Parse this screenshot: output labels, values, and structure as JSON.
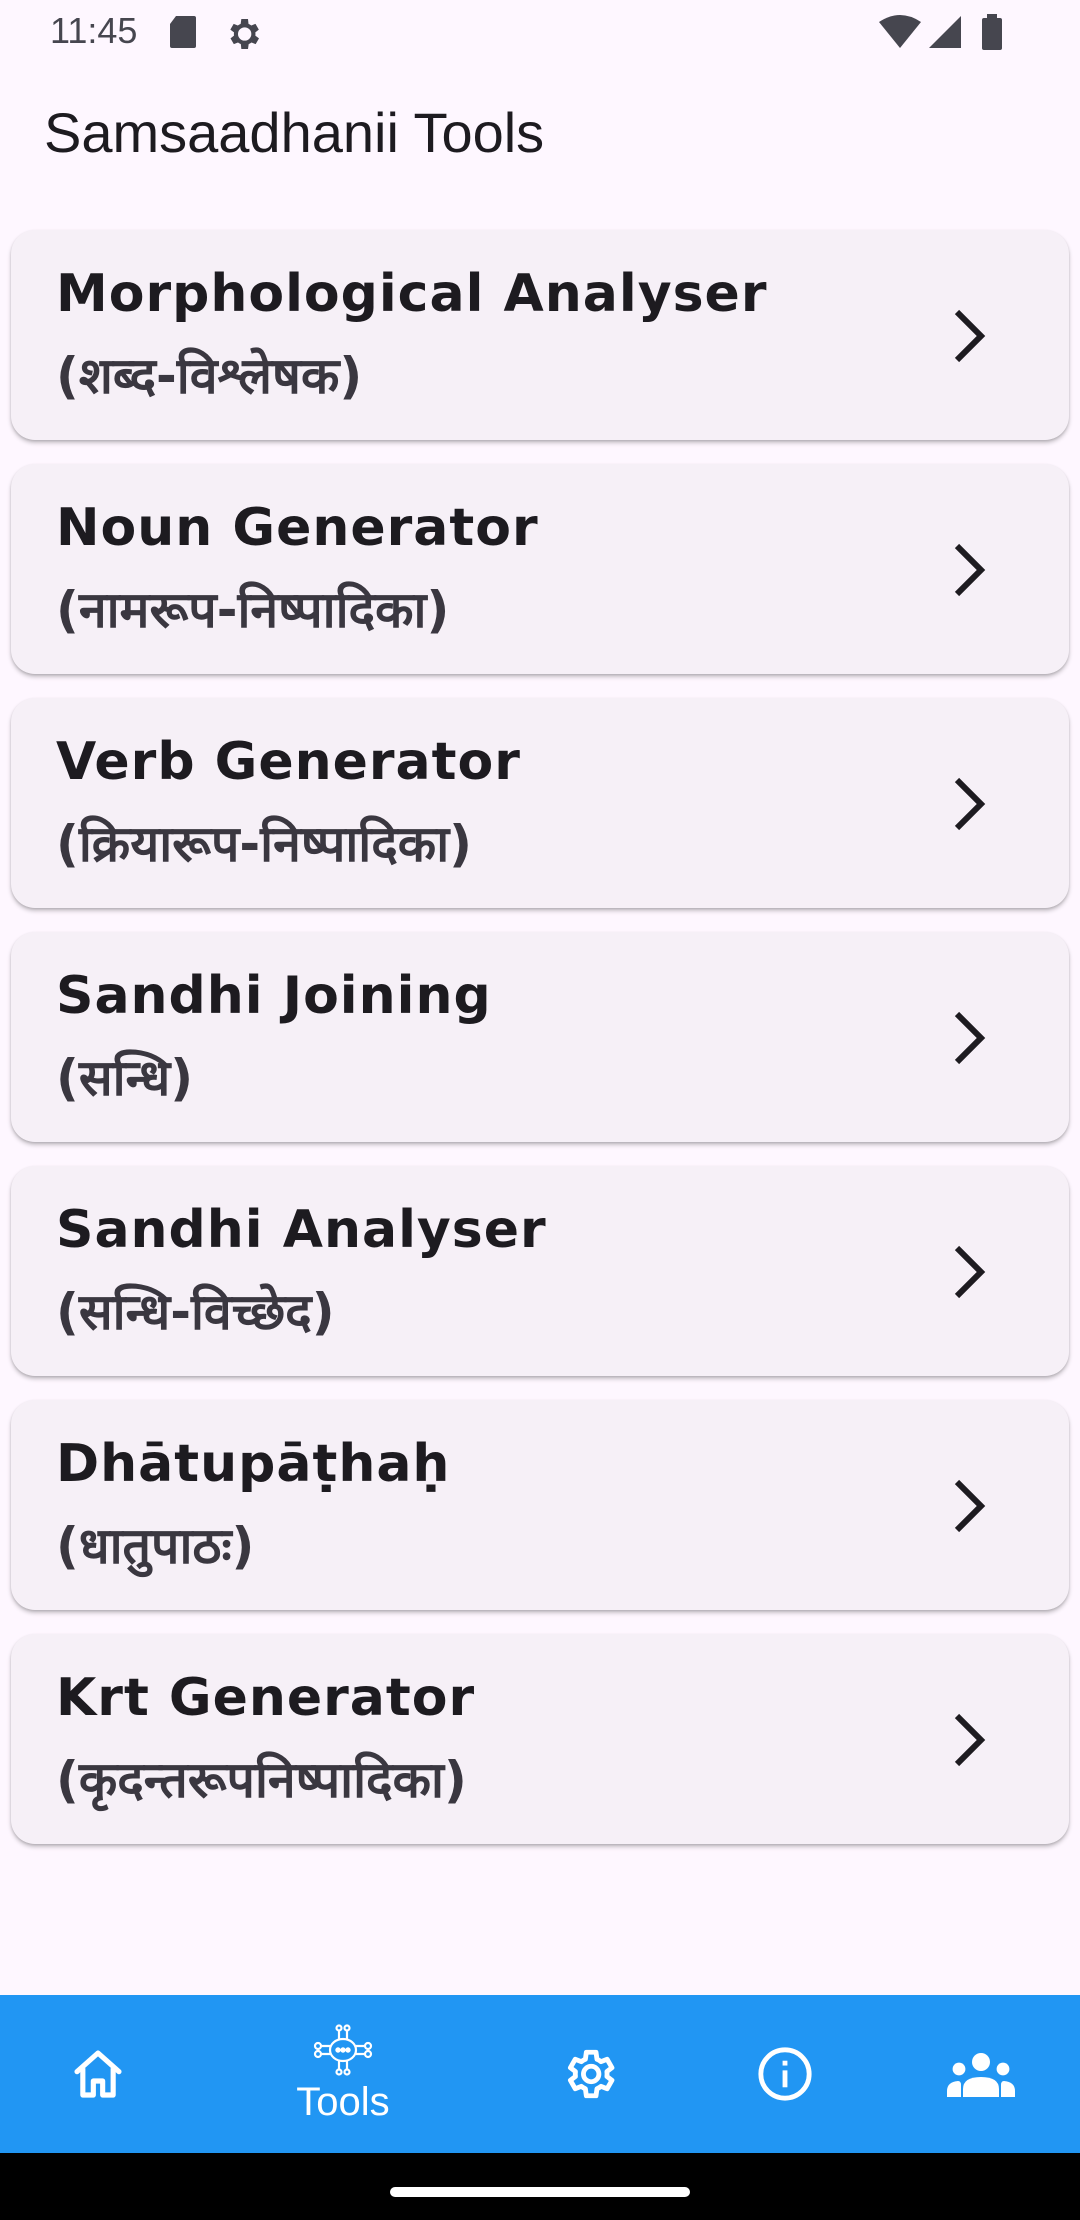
{
  "status_bar": {
    "time": "11:45",
    "left_icons": [
      "sd-card-icon",
      "settings-sync-icon"
    ],
    "right_icons": [
      "wifi-icon",
      "signal-icon",
      "battery-icon"
    ]
  },
  "app_bar": {
    "title": "Samsaadhanii Tools"
  },
  "tools": [
    {
      "title": "Morphological Analyser",
      "subtitle": "(शब्द-विश्लेषक)"
    },
    {
      "title": "Noun Generator",
      "subtitle": "(नामरूप-निष्पादिका)"
    },
    {
      "title": "Verb Generator",
      "subtitle": "(क्रियारूप-निष्पादिका)"
    },
    {
      "title": "Sandhi Joining",
      "subtitle": "(सन्धि)"
    },
    {
      "title": "Sandhi Analyser",
      "subtitle": "(सन्धि-विच्छेद)"
    },
    {
      "title": "Dhātupāṭhaḥ",
      "subtitle": "(धातुपाठः)"
    },
    {
      "title": "Krt Generator",
      "subtitle": "(कृदन्तरूपनिष्पादिका)"
    }
  ],
  "bottom_nav": {
    "selected": "tools",
    "items": [
      {
        "id": "home",
        "icon": "home-icon",
        "label": ""
      },
      {
        "id": "tools",
        "icon": "tools-icon",
        "label": "Tools"
      },
      {
        "id": "settings",
        "icon": "gear-icon",
        "label": ""
      },
      {
        "id": "about",
        "icon": "info-icon",
        "label": ""
      },
      {
        "id": "community",
        "icon": "people-icon",
        "label": ""
      }
    ]
  },
  "colors": {
    "background": "#FEF7FF",
    "card": "#F6F0F7",
    "nav_bar": "#2196F3",
    "text_primary": "#1D1B20"
  }
}
